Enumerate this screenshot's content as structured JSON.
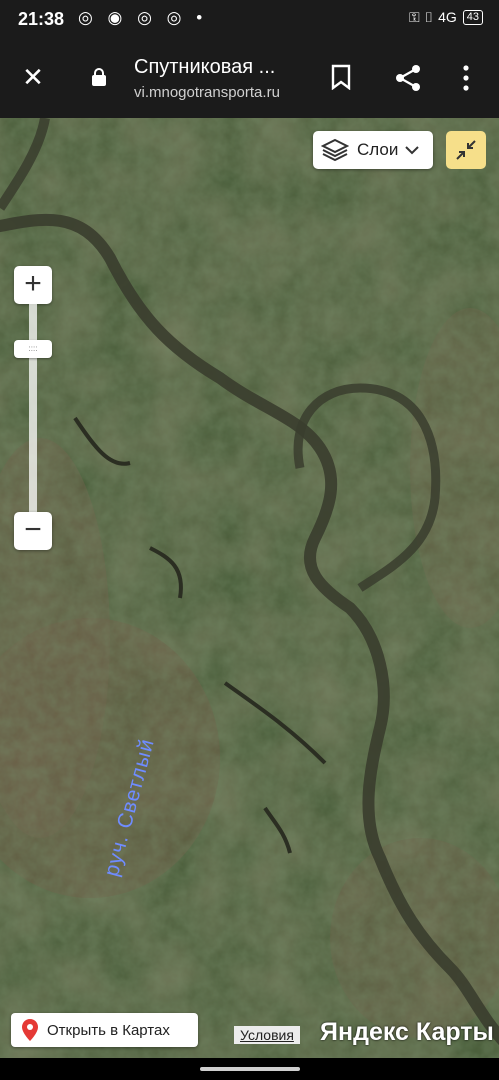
{
  "status": {
    "time": "21:38",
    "left_icons": "◎ ◉ ◎ ◎ •",
    "right_icons": "⚿ ▯ 4G",
    "battery": "43"
  },
  "browser": {
    "title": "Спутниковая ...",
    "url": "vi.mnogotransporta.ru",
    "close_icon": "close-icon",
    "lock_icon": "lock-icon",
    "bookmark_icon": "bookmark-icon",
    "share_icon": "share-icon",
    "more_icon": "more-vert-icon"
  },
  "map": {
    "layers_label": "Слои",
    "zoom_in_label": "+",
    "zoom_out_label": "−",
    "zoom_handle_label": "::::",
    "river_label": "руч. Светлый",
    "open_in_maps_label": "Открыть в Картах",
    "terms_label": "Условия",
    "brand_label": "Яндекс Карты",
    "colors": {
      "fullscreen_button": "#f6df8a",
      "river_label": "#6f8cff",
      "pin": "#e53935"
    }
  }
}
